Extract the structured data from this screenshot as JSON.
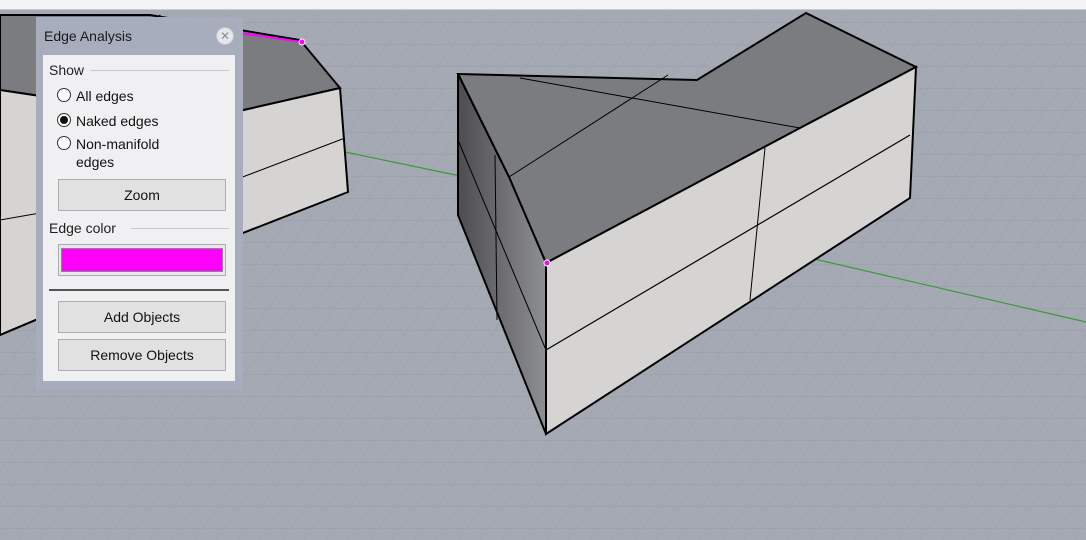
{
  "panel": {
    "title": "Edge Analysis",
    "show_group": {
      "label": "Show",
      "options": [
        {
          "label": "All edges",
          "checked": false
        },
        {
          "label": "Naked edges",
          "checked": true
        },
        {
          "label": "Non-manifold",
          "label_line2": "edges",
          "checked": false
        }
      ]
    },
    "zoom_label": "Zoom",
    "edge_color": {
      "label": "Edge color",
      "value": "#ff00ff"
    },
    "add_objects_label": "Add Objects",
    "remove_objects_label": "Remove Objects"
  },
  "colors": {
    "viewport_background": "#a4a9b3",
    "grid_line": "#979ca7",
    "axis_x": "#3c9a3c",
    "naked_edge_highlight": "#ff00ff",
    "top_face": "#7b7c80",
    "side_face": "#d5d4d2"
  }
}
